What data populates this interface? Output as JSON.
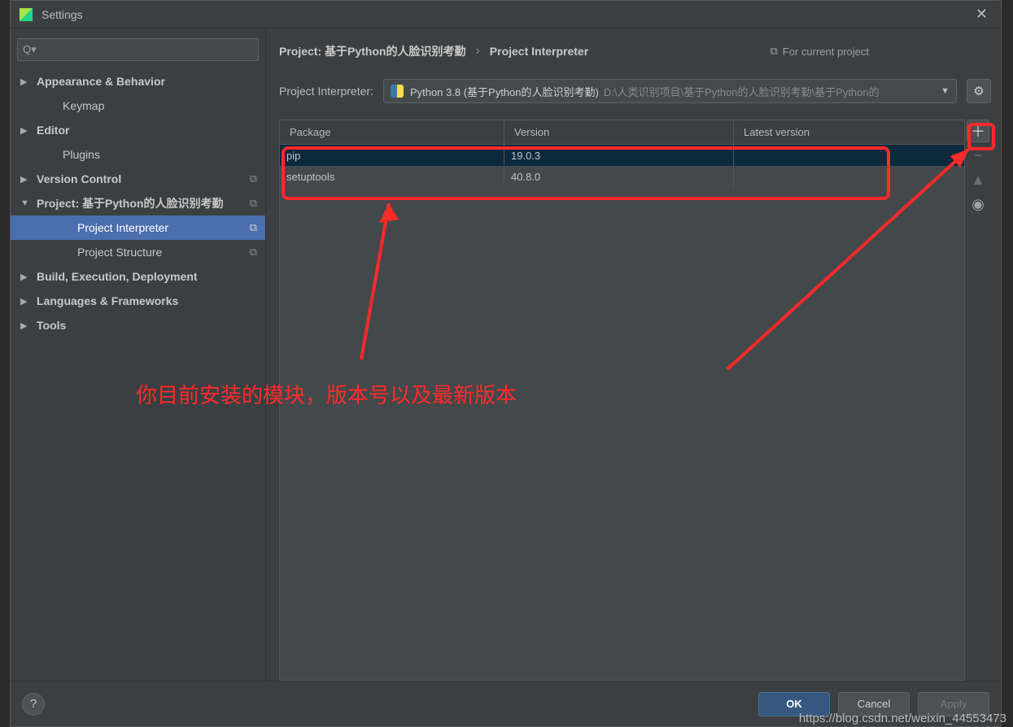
{
  "window": {
    "title": "Settings"
  },
  "search": {
    "placeholder": "",
    "icon_text": "Q▾"
  },
  "sidebar": {
    "items": [
      {
        "label": "Appearance & Behavior",
        "arrow": "right",
        "level": 0,
        "copy": false
      },
      {
        "label": "Keymap",
        "arrow": "none",
        "level": 1,
        "copy": false
      },
      {
        "label": "Editor",
        "arrow": "right",
        "level": 0,
        "copy": false
      },
      {
        "label": "Plugins",
        "arrow": "none",
        "level": 1,
        "copy": false
      },
      {
        "label": "Version Control",
        "arrow": "right",
        "level": 0,
        "copy": true
      },
      {
        "label": "Project: 基于Python的人脸识别考勤",
        "arrow": "down",
        "level": 0,
        "copy": true
      },
      {
        "label": "Project Interpreter",
        "arrow": "none",
        "level": 2,
        "copy": true,
        "selected": true
      },
      {
        "label": "Project Structure",
        "arrow": "none",
        "level": 2,
        "copy": true
      },
      {
        "label": "Build, Execution, Deployment",
        "arrow": "right",
        "level": 0,
        "copy": false
      },
      {
        "label": "Languages & Frameworks",
        "arrow": "right",
        "level": 0,
        "copy": false
      },
      {
        "label": "Tools",
        "arrow": "right",
        "level": 0,
        "copy": false
      }
    ]
  },
  "breadcrumb": {
    "part1": "Project: 基于Python的人脸识别考勤",
    "sep": "›",
    "part2": "Project Interpreter",
    "for_current": "For current project"
  },
  "interpreter": {
    "label": "Project Interpreter:",
    "name": "Python 3.8 (基于Python的人脸识别考勤)",
    "path": "D:\\人类识别项目\\基于Python的人脸识别考勤\\基于Python的"
  },
  "packages": {
    "headers": {
      "c1": "Package",
      "c2": "Version",
      "c3": "Latest version"
    },
    "rows": [
      {
        "name": "pip",
        "version": "19.0.3",
        "latest": "",
        "selected": true
      },
      {
        "name": "setuptools",
        "version": "40.8.0",
        "latest": "",
        "selected": false
      }
    ]
  },
  "footer": {
    "ok": "OK",
    "cancel": "Cancel",
    "apply": "Apply"
  },
  "annotation": {
    "text": "你目前安装的模块，版本号以及最新版本"
  },
  "watermark": {
    "text": "https://blog.csdn.net/weixin_44553473"
  }
}
